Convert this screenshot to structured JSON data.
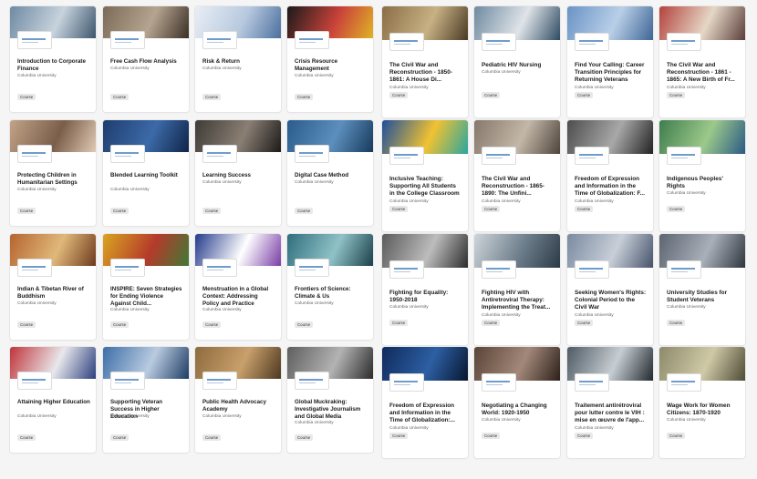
{
  "courses": [
    {
      "title": "Introduction to Corporate Finance",
      "org": "Columbia University",
      "badge": "Course",
      "colors": [
        "#6f8aa3",
        "#c7d3dd",
        "#3d566c"
      ]
    },
    {
      "title": "Free Cash Flow Analysis",
      "org": "Columbia University",
      "badge": "Course",
      "colors": [
        "#7b6a57",
        "#b5a48f",
        "#3a2f26"
      ]
    },
    {
      "title": "Risk & Return",
      "org": "Columbia University",
      "badge": "Course",
      "colors": [
        "#e9eef5",
        "#b7c9df",
        "#4c6f9e"
      ]
    },
    {
      "title": "Crisis Resource Management",
      "org": "Columbia University",
      "badge": "Course",
      "colors": [
        "#1a1a1a",
        "#c9423a",
        "#e0b326"
      ]
    },
    {
      "title": "The Civil War and Reconstruction - 1850-1861: A House Di...",
      "org": "Columbia University",
      "badge": "Course",
      "colors": [
        "#8a6d45",
        "#c7b184",
        "#4a3a24"
      ]
    },
    {
      "title": "Pediatric HIV Nursing",
      "org": "Columbia University",
      "badge": "Course",
      "colors": [
        "#6f8aa0",
        "#dfe4e8",
        "#2f4b63"
      ]
    },
    {
      "title": "Find Your Calling: Career Transition Principles for Returning Veterans",
      "org": "Columbia University",
      "badge": "Course",
      "colors": [
        "#6a93c5",
        "#b9cfe8",
        "#3e6594"
      ]
    },
    {
      "title": "The Civil War and Reconstruction - 1861 - 1865: A New Birth of Fr...",
      "org": "Columbia University",
      "badge": "Course",
      "colors": [
        "#b3433d",
        "#e5d7c6",
        "#5a3e3a"
      ]
    },
    {
      "title": "Protecting Children in Humanitarian Settings",
      "org": "Columbia University",
      "badge": "Course",
      "colors": [
        "#c2a388",
        "#7a5e49",
        "#e0cab5"
      ]
    },
    {
      "title": "Blended Learning Toolkit",
      "org": "Columbia University",
      "badge": "Course",
      "colors": [
        "#1f3d6e",
        "#3c6aa8",
        "#0f2447"
      ]
    },
    {
      "title": "Learning Success",
      "org": "Columbia University",
      "badge": "Course",
      "colors": [
        "#3e3a36",
        "#8a7f74",
        "#1c1a18"
      ]
    },
    {
      "title": "Digital Case Method",
      "org": "Columbia University",
      "badge": "Course",
      "colors": [
        "#2a5b8a",
        "#5c8fbd",
        "#173a5c"
      ]
    },
    {
      "title": "Inclusive Teaching: Supporting All Students in the College Classroom",
      "org": "Columbia University",
      "badge": "Course",
      "colors": [
        "#1d4f9c",
        "#f1c232",
        "#2aa6a0"
      ]
    },
    {
      "title": "The Civil War and Reconstruction - 1865-1890: The Unfini...",
      "org": "Columbia University",
      "badge": "Course",
      "colors": [
        "#86786a",
        "#c3b7a8",
        "#4d443b"
      ]
    },
    {
      "title": "Freedom of Expression and Information in the Time of Globalization: F...",
      "org": "Columbia University",
      "badge": "Course",
      "colors": [
        "#4d4d4d",
        "#a8a8a8",
        "#222222"
      ]
    },
    {
      "title": "Indigenous Peoples' Rights",
      "org": "Columbia University",
      "badge": "Course",
      "colors": [
        "#3f7d4e",
        "#9cc98a",
        "#2a5a86"
      ]
    },
    {
      "title": "Indian & Tibetan River of Buddhism",
      "org": "Columbia University",
      "badge": "Course",
      "colors": [
        "#b5652f",
        "#e0b87a",
        "#6e3a1c"
      ]
    },
    {
      "title": "INSPIRE: Seven Strategies for Ending Violence Against Child...",
      "org": "Columbia University",
      "badge": "Course",
      "colors": [
        "#d9a521",
        "#b53a2b",
        "#3f7a36"
      ]
    },
    {
      "title": "Menstruation in a Global Context: Addressing Policy and Practice",
      "org": "Columbia University",
      "badge": "Course",
      "colors": [
        "#243a8c",
        "#ffffff",
        "#7a3ea6"
      ]
    },
    {
      "title": "Frontiers of Science: Climate & Us",
      "org": "Columbia University",
      "badge": "Course",
      "colors": [
        "#2f6e7d",
        "#8fc2c7",
        "#1b3f4a"
      ]
    },
    {
      "title": "Fighting for Equality: 1950-2018",
      "org": "Columbia University",
      "badge": "Course",
      "colors": [
        "#5a5a5a",
        "#bdbdbd",
        "#2c2c2c"
      ]
    },
    {
      "title": "Fighting HIV with Antiretroviral Therapy: Implementing the Treat...",
      "org": "Columbia University",
      "badge": "Course",
      "colors": [
        "#cfd5da",
        "#6b7c8a",
        "#2c3a45"
      ]
    },
    {
      "title": "Seeking Women's Rights: Colonial Period to the Civil War",
      "org": "Columbia University",
      "badge": "Course",
      "colors": [
        "#7a8aa0",
        "#c8cfd8",
        "#45526a"
      ]
    },
    {
      "title": "University Studies for Student Veterans",
      "org": "Columbia University",
      "badge": "Course",
      "colors": [
        "#5c6470",
        "#a9b0ba",
        "#2f353d"
      ]
    },
    {
      "title": "Attaining Higher Education",
      "org": "Columbia University",
      "badge": "Course",
      "colors": [
        "#c0343a",
        "#e8e8ec",
        "#2b3f7d"
      ]
    },
    {
      "title": "Supporting Veteran Success in Higher Education",
      "org": "Columbia University",
      "badge": "Course",
      "colors": [
        "#3d6ea8",
        "#b9cbe0",
        "#1e3c63"
      ]
    },
    {
      "title": "Public Health Advocacy Academy",
      "org": "Columbia University",
      "badge": "Course",
      "colors": [
        "#8d6a3e",
        "#c8a06b",
        "#4d3820"
      ]
    },
    {
      "title": "Global Muckraking: Investigative Journalism and Global Media",
      "org": "Columbia University",
      "badge": "Course",
      "colors": [
        "#5e5e5e",
        "#b3b3b3",
        "#2b2b2b"
      ]
    },
    {
      "title": "Freedom of Expression and Information in the Time of Globalization:...",
      "org": "Columbia University",
      "badge": "Course",
      "colors": [
        "#0f2a5c",
        "#2d5fa3",
        "#07162f"
      ]
    },
    {
      "title": "Negotiating a Changing World: 1920-1950",
      "org": "Columbia University",
      "badge": "Course",
      "colors": [
        "#5a4438",
        "#a3887a",
        "#2c2019"
      ]
    },
    {
      "title": "Traitement antirétroviral pour lutter contre le VIH : mise en œuvre de l'app...",
      "org": "Columbia University",
      "badge": "Course",
      "colors": [
        "#4f5a63",
        "#c7ced3",
        "#22292e"
      ]
    },
    {
      "title": "Wage Work for Women Citizens: 1870-1920",
      "org": "Columbia University",
      "badge": "Course",
      "colors": [
        "#8c8a6a",
        "#cfc9a6",
        "#4e4b37"
      ]
    }
  ]
}
